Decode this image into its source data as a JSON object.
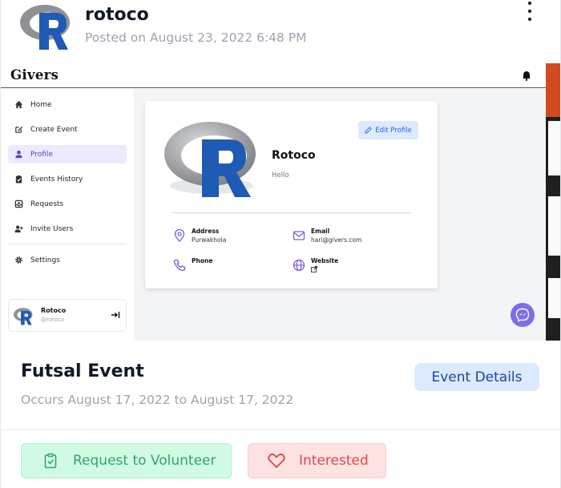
{
  "post": {
    "username": "rotoco",
    "posted": "Posted on August 23, 2022 6:48 PM",
    "avatar_icon": "r-logo-icon",
    "menu_icon": "kebab-menu-icon"
  },
  "screenshot": {
    "app_name": "Givers",
    "sidebar": {
      "items": [
        {
          "label": "Home",
          "icon": "home-icon"
        },
        {
          "label": "Create Event",
          "icon": "edit-square-icon"
        },
        {
          "label": "Profile",
          "icon": "person-icon",
          "active": true
        },
        {
          "label": "Events History",
          "icon": "clipboard-icon"
        },
        {
          "label": "Requests",
          "icon": "inbox-icon"
        },
        {
          "label": "Invite Users",
          "icon": "user-plus-icon"
        },
        {
          "label": "Settings",
          "icon": "gear-icon"
        }
      ],
      "user": {
        "name": "Rotoco",
        "handle": "@rotoco"
      }
    },
    "profile": {
      "name": "Rotoco",
      "bio": "Hello",
      "edit_label": "Edit Profile",
      "fields": [
        {
          "label": "Address",
          "value": "Purwakhola",
          "icon": "map-pin-icon"
        },
        {
          "label": "Email",
          "value": "hari@givers.com",
          "icon": "mail-icon"
        },
        {
          "label": "Phone",
          "value": "",
          "icon": "phone-icon"
        },
        {
          "label": "Website",
          "value": "",
          "icon": "globe-icon"
        }
      ]
    }
  },
  "event": {
    "title": "Futsal Event",
    "dates": "Occurs August 17, 2022 to August 17, 2022",
    "details_label": "Event Details",
    "volunteer_label": "Request to Volunteer",
    "interested_label": "Interested"
  },
  "colors": {
    "accent": "#5b3fd6",
    "details_bg": "#dbeafe",
    "volunteer_bg": "#d1fae5",
    "interested_bg": "#fde2e2"
  }
}
